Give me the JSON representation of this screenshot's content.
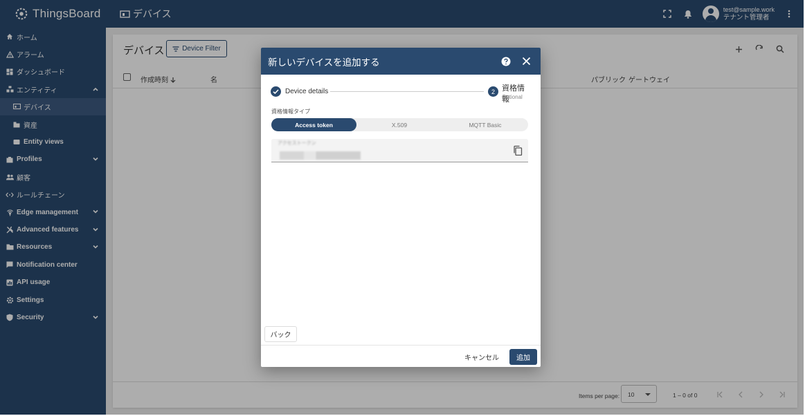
{
  "app": {
    "name": "ThingsBoard"
  },
  "header": {
    "page_title": "デバイス",
    "user_email": "test@sample.work",
    "user_role": "テナント管理者"
  },
  "sidebar": {
    "items": [
      {
        "label": "ホーム",
        "icon": "home-icon"
      },
      {
        "label": "アラーム",
        "icon": "alarm-icon"
      },
      {
        "label": "ダッシュボード",
        "icon": "dashboard-icon"
      },
      {
        "label": "エンティティ",
        "icon": "entity-icon",
        "expanded": true
      },
      {
        "label": "デバイス",
        "icon": "device-icon",
        "active": true
      },
      {
        "label": "資産",
        "icon": "asset-icon"
      },
      {
        "label": "Entity views",
        "icon": "entity-view-icon"
      },
      {
        "label": "Profiles",
        "icon": "profiles-icon"
      },
      {
        "label": "顧客",
        "icon": "customers-icon"
      },
      {
        "label": "ルールチェーン",
        "icon": "rule-chain-icon"
      },
      {
        "label": "Edge management",
        "icon": "edge-icon"
      },
      {
        "label": "Advanced features",
        "icon": "advanced-icon"
      },
      {
        "label": "Resources",
        "icon": "resources-icon"
      },
      {
        "label": "Notification center",
        "icon": "notification-icon"
      },
      {
        "label": "API usage",
        "icon": "api-icon"
      },
      {
        "label": "Settings",
        "icon": "settings-icon"
      },
      {
        "label": "Security",
        "icon": "security-icon"
      }
    ]
  },
  "main": {
    "title": "デバイス",
    "filter_button": "Device Filter",
    "columns": [
      "作成時刻",
      "名",
      "パブリック",
      "ゲートウェイ"
    ],
    "pagination": {
      "items_per_page_label": "Items per page:",
      "items_per_page_value": "10",
      "range": "1 – 0 of 0"
    }
  },
  "dialog": {
    "title": "新しいデバイスを追加する",
    "step1_label": "Device details",
    "step2_number": "2",
    "step2_label": "資格情報",
    "step2_sub": "Optional",
    "credential_type_label": "資格情報タイプ",
    "options": [
      "Access token",
      "X.509",
      "MQTT Basic"
    ],
    "token_label": "アクセストークン",
    "back_button": "バック",
    "cancel_button": "キャンセル",
    "add_button": "追加"
  }
}
